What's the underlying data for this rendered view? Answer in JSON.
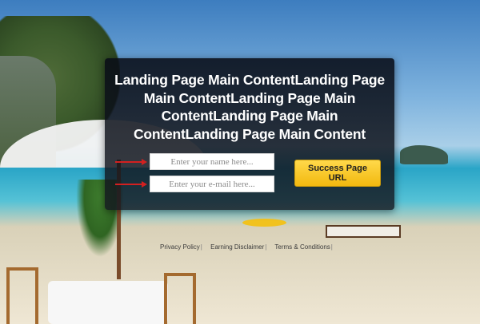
{
  "hero": {
    "headline": "Landing Page Main ContentLanding Page Main ContentLanding Page Main ContentLanding Page Main ContentLanding Page Main Content"
  },
  "form": {
    "name_placeholder": "Enter your name here...",
    "email_placeholder": "Enter your e-mail here...",
    "submit_label": "Success Page URL",
    "arrow_color": "#d32020",
    "button_color": "#f5c21a"
  },
  "footer": {
    "links": [
      {
        "label": "Privacy Policy",
        "sep": "|"
      },
      {
        "label": "Earning Disclaimer",
        "sep": "|"
      },
      {
        "label": "Terms & Conditions",
        "sep": "|"
      }
    ]
  }
}
